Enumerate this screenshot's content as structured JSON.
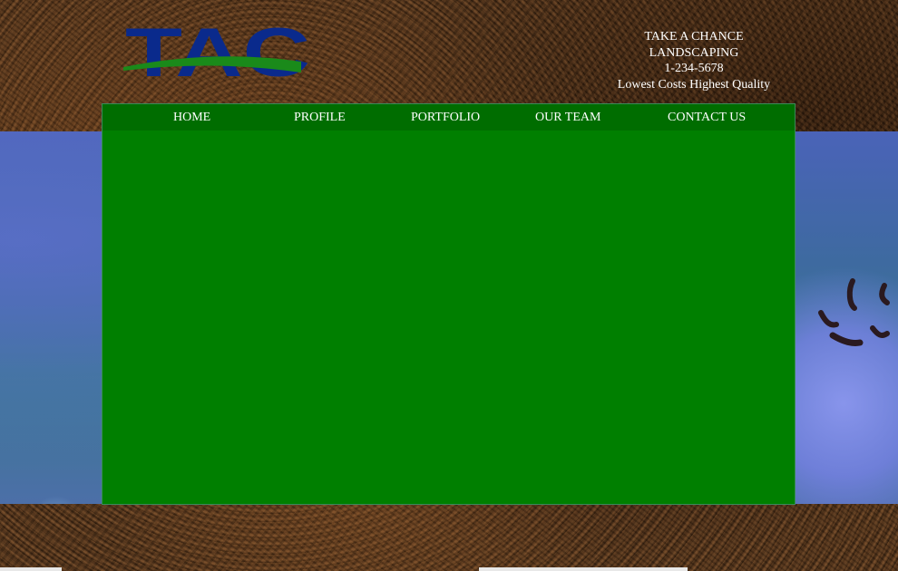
{
  "logo": {
    "text": "TAC",
    "primary_color": "#0a2a8c",
    "swoosh_color": "#1a8a1a"
  },
  "contact": {
    "line1": "TAKE A CHANCE",
    "line2": "LANDSCAPING",
    "phone": "1-234-5678",
    "tagline": "Lowest Costs Highest Quality"
  },
  "nav": {
    "items": [
      {
        "label": "HOME"
      },
      {
        "label": "PROFILE"
      },
      {
        "label": "PORTFOLIO"
      },
      {
        "label": "OUR TEAM"
      },
      {
        "label": "CONTACT US"
      }
    ]
  },
  "colors": {
    "panel": "#007f00",
    "nav_bar": "#006d00",
    "text": "#ffffff"
  }
}
